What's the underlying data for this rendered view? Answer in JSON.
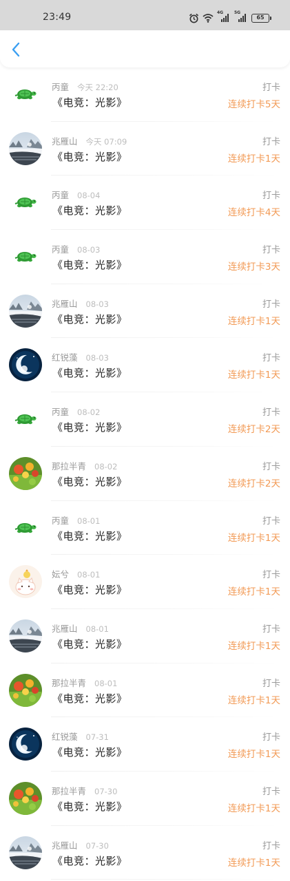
{
  "status_bar": {
    "time": "23:49",
    "battery": "65",
    "net1": "4G",
    "net2": "5G"
  },
  "nav": {
    "back_icon": "chevron-left-icon",
    "accent": "#3a9ff2"
  },
  "colors": {
    "streak": "#f29a55",
    "muted": "#9a9a9a"
  },
  "items": [
    {
      "name": "丙童",
      "time": "今天 22:20",
      "title": "《电竞：光影》",
      "action": "打卡",
      "streak": "连续打卡5天",
      "avatar": "turtle"
    },
    {
      "name": "兆雁山",
      "time": "今天 07:09",
      "title": "《电竞：光影》",
      "action": "打卡",
      "streak": "连续打卡1天",
      "avatar": "snow"
    },
    {
      "name": "丙童",
      "time": "08-04",
      "title": "《电竞：光影》",
      "action": "打卡",
      "streak": "连续打卡4天",
      "avatar": "turtle"
    },
    {
      "name": "丙童",
      "time": "08-03",
      "title": "《电竞：光影》",
      "action": "打卡",
      "streak": "连续打卡3天",
      "avatar": "turtle"
    },
    {
      "name": "兆雁山",
      "time": "08-03",
      "title": "《电竞：光影》",
      "action": "打卡",
      "streak": "连续打卡1天",
      "avatar": "snow"
    },
    {
      "name": "红锐藻",
      "time": "08-03",
      "title": "《电竞：光影》",
      "action": "打卡",
      "streak": "连续打卡1天",
      "avatar": "moon"
    },
    {
      "name": "丙童",
      "time": "08-02",
      "title": "《电竞：光影》",
      "action": "打卡",
      "streak": "连续打卡2天",
      "avatar": "turtle"
    },
    {
      "name": "那拉半青",
      "time": "08-02",
      "title": "《电竞：光影》",
      "action": "打卡",
      "streak": "连续打卡2天",
      "avatar": "flower"
    },
    {
      "name": "丙童",
      "time": "08-01",
      "title": "《电竞：光影》",
      "action": "打卡",
      "streak": "连续打卡1天",
      "avatar": "turtle"
    },
    {
      "name": "妘兮",
      "time": "08-01",
      "title": "《电竞：光影》",
      "action": "打卡",
      "streak": "连续打卡1天",
      "avatar": "cat"
    },
    {
      "name": "兆雁山",
      "time": "08-01",
      "title": "《电竞：光影》",
      "action": "打卡",
      "streak": "连续打卡1天",
      "avatar": "snow"
    },
    {
      "name": "那拉半青",
      "time": "08-01",
      "title": "《电竞：光影》",
      "action": "打卡",
      "streak": "连续打卡1天",
      "avatar": "flower"
    },
    {
      "name": "红锐藻",
      "time": "07-31",
      "title": "《电竞：光影》",
      "action": "打卡",
      "streak": "连续打卡1天",
      "avatar": "moon"
    },
    {
      "name": "那拉半青",
      "time": "07-30",
      "title": "《电竞：光影》",
      "action": "打卡",
      "streak": "连续打卡1天",
      "avatar": "flower"
    },
    {
      "name": "兆雁山",
      "time": "07-30",
      "title": "《电竞：光影》",
      "action": "打卡",
      "streak": "连续打卡1天",
      "avatar": "snow"
    }
  ]
}
